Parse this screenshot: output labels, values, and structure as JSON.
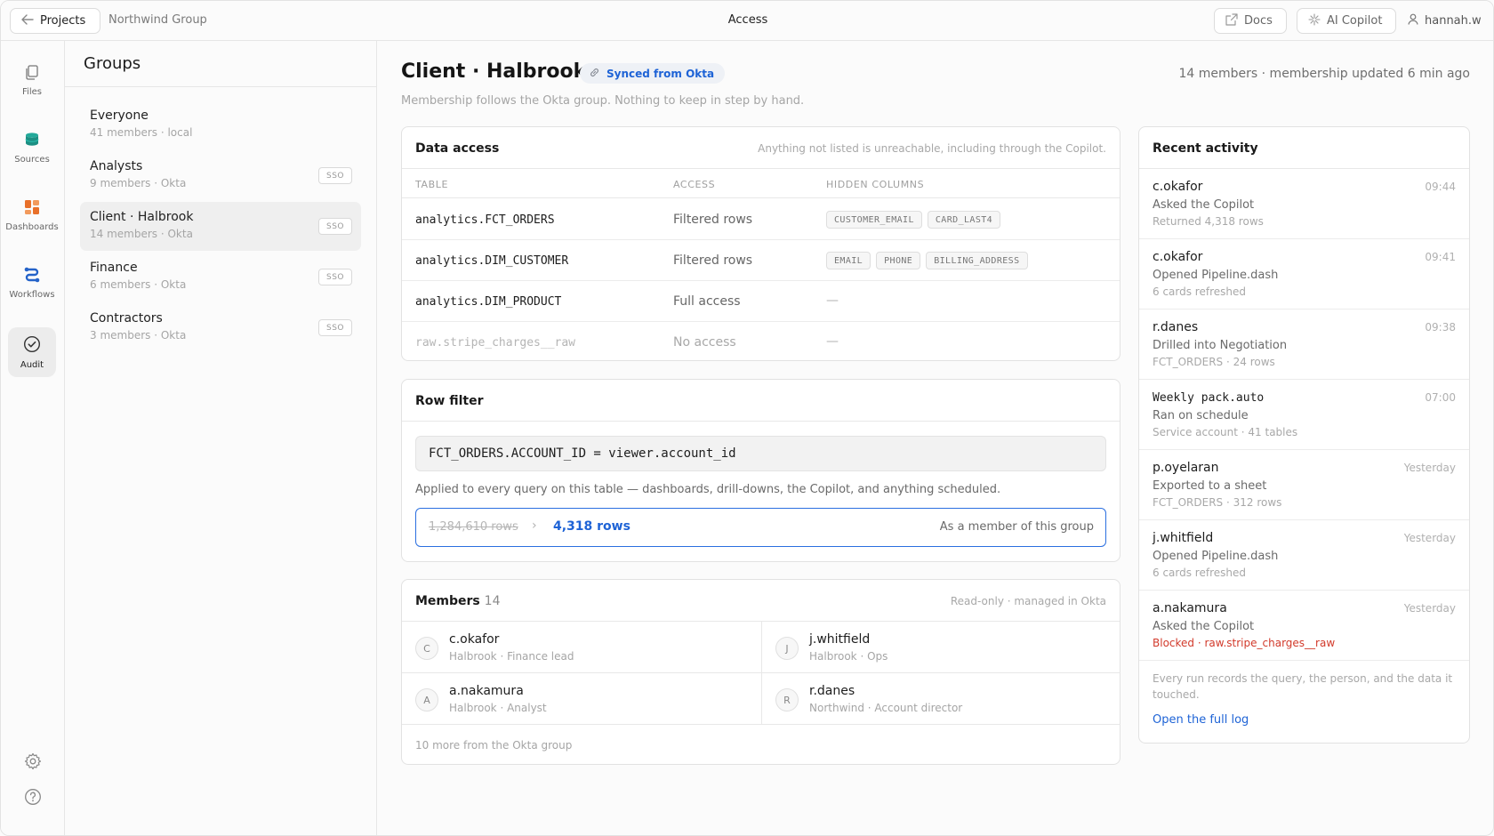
{
  "topbar": {
    "back_label": "Projects",
    "org": "Northwind Group",
    "title": "Access",
    "docs_label": "Docs",
    "copilot_label": "AI Copilot",
    "user": "hannah.w"
  },
  "rail": {
    "items": [
      {
        "label": "Files",
        "icon": "files-icon"
      },
      {
        "label": "Sources",
        "icon": "database-icon"
      },
      {
        "label": "Dashboards",
        "icon": "dashboard-icon"
      },
      {
        "label": "Workflows",
        "icon": "workflow-icon"
      },
      {
        "label": "Audit",
        "icon": "check-circle-icon",
        "active": true
      }
    ],
    "bottom": [
      "gear-icon",
      "help-icon"
    ]
  },
  "groups": {
    "title": "Groups",
    "items": [
      {
        "name": "Everyone",
        "meta": "41 members · local",
        "badge": ""
      },
      {
        "name": "Analysts",
        "meta": "9 members · Okta",
        "badge": "SSO"
      },
      {
        "name": "Client · Halbrook",
        "meta": "14 members · Okta",
        "badge": "SSO",
        "active": true
      },
      {
        "name": "Finance",
        "meta": "6 members · Okta",
        "badge": "SSO"
      },
      {
        "name": "Contractors",
        "meta": "3 members · Okta",
        "badge": "SSO"
      }
    ]
  },
  "main": {
    "title": "Client · Halbrook",
    "synced": "Synced from Okta",
    "summary": "14 members · membership updated 6 min ago",
    "subtitle": "Membership follows the Okta group. Nothing to keep in step by hand."
  },
  "data_access": {
    "title": "Data access",
    "note": "Anything not listed is unreachable, including through the Copilot.",
    "headers": [
      "TABLE",
      "ACCESS",
      "HIDDEN COLUMNS"
    ],
    "rows": [
      {
        "table": "analytics.FCT_ORDERS",
        "access": "Filtered rows",
        "hidden": [
          "CUSTOMER_EMAIL",
          "CARD_LAST4"
        ],
        "dash": ""
      },
      {
        "table": "analytics.DIM_CUSTOMER",
        "access": "Filtered rows",
        "hidden": [
          "EMAIL",
          "PHONE",
          "BILLING_ADDRESS"
        ],
        "dash": ""
      },
      {
        "table": "analytics.DIM_PRODUCT",
        "access": "Full access",
        "hidden": [],
        "dash": "—"
      },
      {
        "table": "raw.stripe_charges__raw",
        "access": "No access",
        "hidden": [],
        "dash": "—",
        "muted": true
      }
    ]
  },
  "row_filter": {
    "title": "Row filter",
    "expression": "FCT_ORDERS.ACCOUNT_ID = viewer.account_id",
    "description": "Applied to every query on this table — dashboards, drill-downs, the Copilot, and anything scheduled.",
    "rows_before": "1,284,610 rows",
    "chevron": "›",
    "rows_after": "4,318 rows",
    "rows_note": "As a member of this group"
  },
  "members": {
    "title": "Members",
    "count": "14",
    "note": "Read-only · managed in Okta",
    "list": [
      {
        "initial": "C",
        "name": "c.okafor",
        "role": "Halbrook · Finance lead"
      },
      {
        "initial": "J",
        "name": "j.whitfield",
        "role": "Halbrook · Ops"
      },
      {
        "initial": "A",
        "name": "a.nakamura",
        "role": "Halbrook · Analyst"
      },
      {
        "initial": "R",
        "name": "r.danes",
        "role": "Northwind · Account director"
      }
    ],
    "more": "10 more from the Okta group"
  },
  "activity": {
    "title": "Recent activity",
    "items": [
      {
        "who": "c.okafor",
        "time": "09:44",
        "what": "Asked the Copilot",
        "detail": "Returned 4,318 rows"
      },
      {
        "who": "c.okafor",
        "time": "09:41",
        "what": "Opened Pipeline.dash",
        "detail": "6 cards refreshed"
      },
      {
        "who": "r.danes",
        "time": "09:38",
        "what": "Drilled into Negotiation",
        "detail": "FCT_ORDERS · 24 rows"
      },
      {
        "who": "Weekly pack.auto",
        "time": "07:00",
        "what": "Ran on schedule",
        "detail": "Service account · 41 tables",
        "mono": true
      },
      {
        "who": "p.oyelaran",
        "time": "Yesterday",
        "what": "Exported to a sheet",
        "detail": "FCT_ORDERS · 312 rows"
      },
      {
        "who": "j.whitfield",
        "time": "Yesterday",
        "what": "Opened Pipeline.dash",
        "detail": "6 cards refreshed"
      },
      {
        "who": "a.nakamura",
        "time": "Yesterday",
        "what": "Asked the Copilot",
        "detail": "Blocked · raw.stripe_charges__raw",
        "blocked": true
      }
    ],
    "footer": "Every run records the query, the person, and the data it touched.",
    "link": "Open the full log"
  },
  "colors": {
    "accent": "#1e63d6",
    "blocked": "#d23a2b",
    "sources": "#22a99a",
    "dashboards": "#e8702a",
    "workflows": "#2563c9"
  }
}
